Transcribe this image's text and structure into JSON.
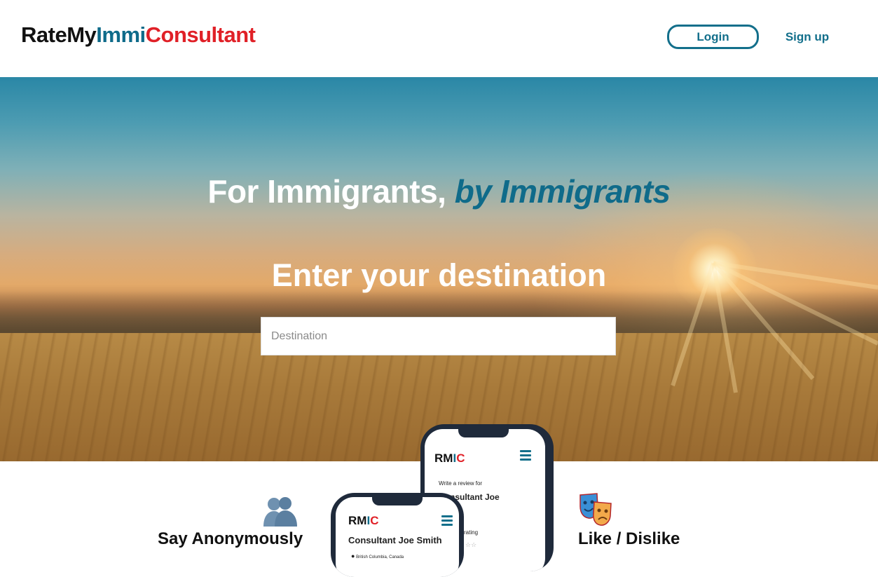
{
  "header": {
    "logo": {
      "part1": "RateMy",
      "part2": "Immi",
      "part3": "Consultant"
    },
    "login_label": "Login",
    "signup_label": "Sign up"
  },
  "hero": {
    "title_prefix": "For Immigrants, ",
    "title_accent": "by Immigrants",
    "subtitle": "Enter your destination",
    "destination_placeholder": "Destination"
  },
  "features": {
    "left_title": "Say Anonymously",
    "right_title": "Like / Dislike"
  },
  "phones": {
    "back": {
      "brand": {
        "r": "RM",
        "i": "I",
        "c": "C"
      },
      "write_review": "Write a review for",
      "consultant_line1": "Consultant Joe",
      "consultant_line2": "th",
      "rating_label": "rating"
    },
    "front": {
      "brand": {
        "r": "RM",
        "i": "I",
        "c": "C"
      },
      "consultant": "Consultant Joe Smith",
      "location": "British Columbia, Canada"
    }
  },
  "colors": {
    "brand_teal": "#0f6b8a",
    "brand_red": "#e02027"
  }
}
